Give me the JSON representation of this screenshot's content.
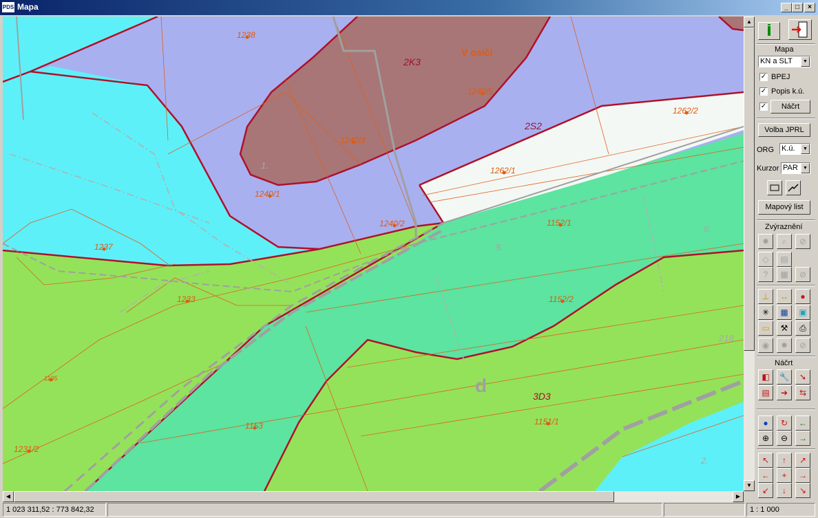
{
  "window": {
    "title": "Mapa",
    "app_icon_text": "PDS",
    "minimize_label": "_",
    "maximize_label": "□",
    "close_label": "×"
  },
  "map": {
    "parcel_labels": [
      "1238",
      "1240/5",
      "1240/3",
      "1240/1",
      "1240/2",
      "1262/2",
      "1262/1",
      "1237",
      "1233",
      "1152/1",
      "1152/2",
      "1153",
      "1151/1",
      "1231/2",
      "1135",
      "5"
    ],
    "zone_labels": [
      "2K3",
      "2S2",
      "3D3",
      "d"
    ],
    "locality": "V osiči",
    "grey_labels": [
      "1.",
      "5.",
      "6.",
      "2.",
      "218"
    ]
  },
  "panel": {
    "mapa_label": "Mapa",
    "map_select": "KN a SLT",
    "bpej_label": "BPEJ",
    "bpej_checked": true,
    "popis_label": "Popis k.ú.",
    "popis_checked": true,
    "nacrt_checked": true,
    "nacrt_button": "Náčrt",
    "volba_button": "Volba JPRL",
    "org_label": "ORG",
    "org_select": "K.ú.",
    "kurzor_label": "Kurzor",
    "kurzor_select": "PAR",
    "mapovy_button": "Mapový list",
    "zvyrazneni_label": "Zvýraznění",
    "nacrt_section_label": "Náčrt"
  },
  "status": {
    "coordinates": "1 023 311,52 : 773 842,32",
    "scale": "1 : 1 000"
  },
  "colors": {
    "cyan": "#5ef0f8",
    "lavender": "#a8b0f0",
    "brown": "#a87676",
    "green": "#94e25a",
    "teal": "#5ce4a0",
    "white": "#f4f8f4",
    "boundary": "#b0102a",
    "orange_text": "#e05a10"
  }
}
